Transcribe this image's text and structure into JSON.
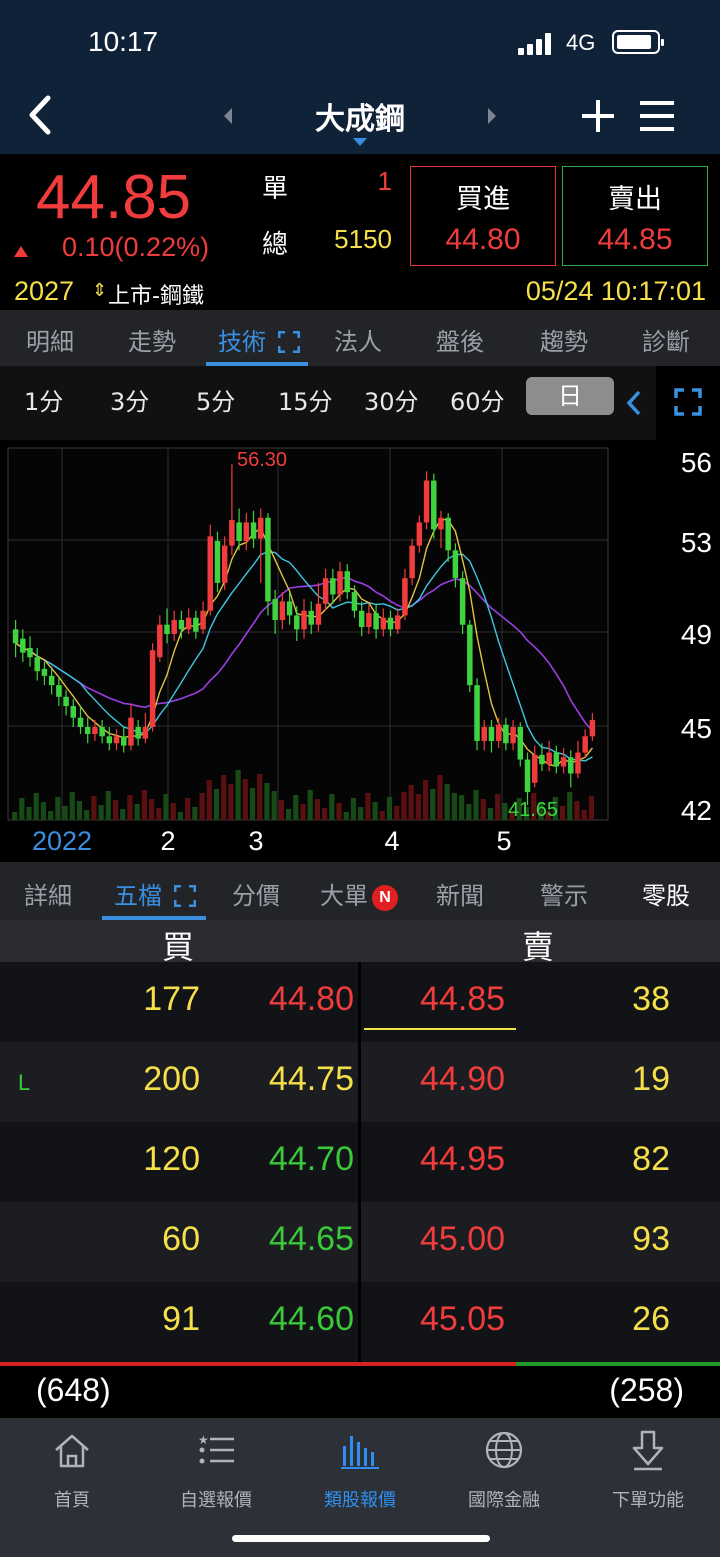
{
  "status": {
    "time": "10:17",
    "network": "4G"
  },
  "nav": {
    "title": "大成鋼"
  },
  "quote": {
    "price": "44.85",
    "change": "0.10(0.22%)",
    "single_label": "單",
    "single_value": "1",
    "total_label": "總",
    "total_value": "5150",
    "buy_label": "買進",
    "buy_price": "44.80",
    "sell_label": "賣出",
    "sell_price": "44.85",
    "code": "2027",
    "market": "上市-鋼鐵",
    "datetime": "05/24 10:17:01"
  },
  "main_tabs": [
    "明細",
    "走勢",
    "技術",
    "法人",
    "盤後",
    "趨勢",
    "診斷"
  ],
  "periods": [
    "1分",
    "3分",
    "5分",
    "15分",
    "30分",
    "60分",
    "日"
  ],
  "chart_data": {
    "type": "candlestick",
    "y_ticks": [
      "56",
      "53",
      "49",
      "45",
      "42"
    ],
    "x_ticks": [
      "2022",
      "2",
      "3",
      "4",
      "5"
    ],
    "high_label": "56.30",
    "low_label": "41.65",
    "grid": true,
    "ylim": [
      41,
      57
    ],
    "candles": [
      {
        "o": 49.2,
        "c": 48.6,
        "h": 49.6,
        "l": 48.0
      },
      {
        "o": 48.8,
        "c": 48.2,
        "h": 49.2,
        "l": 47.8
      },
      {
        "o": 48.4,
        "c": 48.0,
        "h": 48.9,
        "l": 47.6
      },
      {
        "o": 48.0,
        "c": 47.4,
        "h": 48.4,
        "l": 47.0
      },
      {
        "o": 47.5,
        "c": 47.2,
        "h": 47.8,
        "l": 46.8
      },
      {
        "o": 47.2,
        "c": 46.8,
        "h": 47.6,
        "l": 46.4
      },
      {
        "o": 46.8,
        "c": 46.3,
        "h": 47.1,
        "l": 45.9
      },
      {
        "o": 46.3,
        "c": 45.9,
        "h": 46.6,
        "l": 45.5
      },
      {
        "o": 45.9,
        "c": 45.4,
        "h": 46.2,
        "l": 45.0
      },
      {
        "o": 45.4,
        "c": 45.0,
        "h": 45.9,
        "l": 44.7
      },
      {
        "o": 45.0,
        "c": 44.7,
        "h": 45.4,
        "l": 44.3
      },
      {
        "o": 44.7,
        "c": 45.0,
        "h": 45.3,
        "l": 44.4
      },
      {
        "o": 45.0,
        "c": 44.6,
        "h": 45.3,
        "l": 44.3
      },
      {
        "o": 44.6,
        "c": 44.3,
        "h": 45.0,
        "l": 44.0
      },
      {
        "o": 44.3,
        "c": 44.6,
        "h": 44.9,
        "l": 44.0
      },
      {
        "o": 44.6,
        "c": 44.2,
        "h": 45.0,
        "l": 43.9
      },
      {
        "o": 44.2,
        "c": 45.4,
        "h": 46.0,
        "l": 44.0
      },
      {
        "o": 45.0,
        "c": 44.5,
        "h": 45.3,
        "l": 44.2
      },
      {
        "o": 44.5,
        "c": 45.0,
        "h": 45.6,
        "l": 44.3
      },
      {
        "o": 45.0,
        "c": 48.3,
        "h": 48.6,
        "l": 44.8
      },
      {
        "o": 48.0,
        "c": 49.4,
        "h": 49.8,
        "l": 47.8
      },
      {
        "o": 49.4,
        "c": 49.0,
        "h": 50.1,
        "l": 48.6
      },
      {
        "o": 49.0,
        "c": 49.6,
        "h": 50.0,
        "l": 48.7
      },
      {
        "o": 49.6,
        "c": 49.2,
        "h": 50.0,
        "l": 48.8
      },
      {
        "o": 49.2,
        "c": 49.7,
        "h": 50.1,
        "l": 49.0
      },
      {
        "o": 49.7,
        "c": 49.1,
        "h": 50.0,
        "l": 48.8
      },
      {
        "o": 49.2,
        "c": 50.0,
        "h": 50.4,
        "l": 49.0
      },
      {
        "o": 50.0,
        "c": 53.2,
        "h": 53.7,
        "l": 49.8
      },
      {
        "o": 53.0,
        "c": 51.2,
        "h": 53.4,
        "l": 50.8
      },
      {
        "o": 51.2,
        "c": 52.8,
        "h": 53.2,
        "l": 50.9
      },
      {
        "o": 52.8,
        "c": 53.9,
        "h": 56.3,
        "l": 52.4
      },
      {
        "o": 53.8,
        "c": 53.0,
        "h": 54.4,
        "l": 52.6
      },
      {
        "o": 53.0,
        "c": 53.8,
        "h": 54.2,
        "l": 52.6
      },
      {
        "o": 53.8,
        "c": 53.1,
        "h": 54.3,
        "l": 52.7
      },
      {
        "o": 53.1,
        "c": 54.0,
        "h": 54.4,
        "l": 51.2
      },
      {
        "o": 54.0,
        "c": 50.4,
        "h": 54.2,
        "l": 49.8
      },
      {
        "o": 50.5,
        "c": 49.6,
        "h": 50.9,
        "l": 49.0
      },
      {
        "o": 49.6,
        "c": 50.4,
        "h": 50.8,
        "l": 49.2
      },
      {
        "o": 50.4,
        "c": 49.8,
        "h": 50.8,
        "l": 49.4
      },
      {
        "o": 49.8,
        "c": 49.2,
        "h": 50.2,
        "l": 48.7
      },
      {
        "o": 49.2,
        "c": 50.0,
        "h": 50.5,
        "l": 48.8
      },
      {
        "o": 50.0,
        "c": 49.4,
        "h": 50.4,
        "l": 49.0
      },
      {
        "o": 49.4,
        "c": 50.3,
        "h": 51.2,
        "l": 49.1
      },
      {
        "o": 50.3,
        "c": 51.4,
        "h": 51.8,
        "l": 50.0
      },
      {
        "o": 51.4,
        "c": 50.7,
        "h": 51.8,
        "l": 50.3
      },
      {
        "o": 50.7,
        "c": 51.7,
        "h": 52.1,
        "l": 50.4
      },
      {
        "o": 51.7,
        "c": 50.8,
        "h": 52.0,
        "l": 50.5
      },
      {
        "o": 50.8,
        "c": 50.0,
        "h": 51.1,
        "l": 49.7
      },
      {
        "o": 50.0,
        "c": 49.3,
        "h": 50.4,
        "l": 48.9
      },
      {
        "o": 49.3,
        "c": 49.9,
        "h": 50.3,
        "l": 49.0
      },
      {
        "o": 49.9,
        "c": 49.2,
        "h": 50.3,
        "l": 48.8
      },
      {
        "o": 49.2,
        "c": 49.7,
        "h": 50.1,
        "l": 48.9
      },
      {
        "o": 49.7,
        "c": 49.2,
        "h": 50.0,
        "l": 48.9
      },
      {
        "o": 49.2,
        "c": 49.8,
        "h": 50.1,
        "l": 49.0
      },
      {
        "o": 49.8,
        "c": 51.4,
        "h": 51.8,
        "l": 49.6
      },
      {
        "o": 51.4,
        "c": 52.8,
        "h": 53.1,
        "l": 51.1
      },
      {
        "o": 52.8,
        "c": 53.8,
        "h": 54.1,
        "l": 52.5
      },
      {
        "o": 53.8,
        "c": 55.6,
        "h": 56.0,
        "l": 53.5
      },
      {
        "o": 55.6,
        "c": 53.5,
        "h": 55.9,
        "l": 53.1
      },
      {
        "o": 53.5,
        "c": 54.0,
        "h": 54.3,
        "l": 52.7
      },
      {
        "o": 54.0,
        "c": 52.6,
        "h": 54.2,
        "l": 52.1
      },
      {
        "o": 52.6,
        "c": 51.4,
        "h": 52.9,
        "l": 51.0
      },
      {
        "o": 51.4,
        "c": 49.4,
        "h": 51.7,
        "l": 49.0
      },
      {
        "o": 49.4,
        "c": 46.8,
        "h": 49.6,
        "l": 46.5
      },
      {
        "o": 46.8,
        "c": 44.4,
        "h": 47.1,
        "l": 44.0
      },
      {
        "o": 44.4,
        "c": 45.0,
        "h": 45.3,
        "l": 44.0
      },
      {
        "o": 45.0,
        "c": 44.4,
        "h": 45.3,
        "l": 43.9
      },
      {
        "o": 44.4,
        "c": 45.1,
        "h": 45.4,
        "l": 44.1
      },
      {
        "o": 45.1,
        "c": 44.3,
        "h": 45.4,
        "l": 44.0
      },
      {
        "o": 44.3,
        "c": 45.0,
        "h": 45.3,
        "l": 44.0
      },
      {
        "o": 45.0,
        "c": 43.6,
        "h": 45.2,
        "l": 43.3
      },
      {
        "o": 43.6,
        "c": 42.2,
        "h": 43.9,
        "l": 41.65
      },
      {
        "o": 42.6,
        "c": 43.8,
        "h": 44.2,
        "l": 42.4
      },
      {
        "o": 43.8,
        "c": 43.4,
        "h": 44.3,
        "l": 43.1
      },
      {
        "o": 43.4,
        "c": 43.9,
        "h": 44.4,
        "l": 43.1
      },
      {
        "o": 43.9,
        "c": 43.3,
        "h": 44.2,
        "l": 43.0
      },
      {
        "o": 43.3,
        "c": 43.7,
        "h": 44.1,
        "l": 43.0
      },
      {
        "o": 43.7,
        "c": 43.0,
        "h": 44.0,
        "l": 42.4
      },
      {
        "o": 43.0,
        "c": 43.9,
        "h": 44.4,
        "l": 42.8
      },
      {
        "o": 43.9,
        "c": 44.6,
        "h": 44.9,
        "l": 43.7
      },
      {
        "o": 44.6,
        "c": 45.3,
        "h": 45.6,
        "l": 44.4
      }
    ]
  },
  "sub_tabs": [
    "詳細",
    "五檔",
    "分價",
    "大單",
    "新聞",
    "警示",
    "零股"
  ],
  "badge": "N",
  "order_book": {
    "bid_header": "買",
    "ask_header": "賣",
    "l_mark": "L",
    "rows": [
      {
        "bid_vol": "177",
        "bid_price": "44.80",
        "ask_price": "44.85",
        "ask_vol": "38"
      },
      {
        "bid_vol": "200",
        "bid_price": "44.75",
        "ask_price": "44.90",
        "ask_vol": "19"
      },
      {
        "bid_vol": "120",
        "bid_price": "44.70",
        "ask_price": "44.95",
        "ask_vol": "82"
      },
      {
        "bid_vol": "60",
        "bid_price": "44.65",
        "ask_price": "45.00",
        "ask_vol": "93"
      },
      {
        "bid_vol": "91",
        "bid_price": "44.60",
        "ask_price": "45.05",
        "ask_vol": "26"
      }
    ],
    "bid_total": "(648)",
    "ask_total": "(258)",
    "colors": {
      "up": "#f03c3c",
      "down": "#39c939",
      "flat": "#f5e04a",
      "vol": "#f5e04a"
    }
  },
  "bottom_nav": [
    {
      "label": "首頁",
      "icon": "home-icon"
    },
    {
      "label": "自選報價",
      "icon": "list-icon"
    },
    {
      "label": "類股報價",
      "icon": "bars-icon"
    },
    {
      "label": "國際金融",
      "icon": "globe-icon"
    },
    {
      "label": "下單功能",
      "icon": "order-icon"
    }
  ]
}
